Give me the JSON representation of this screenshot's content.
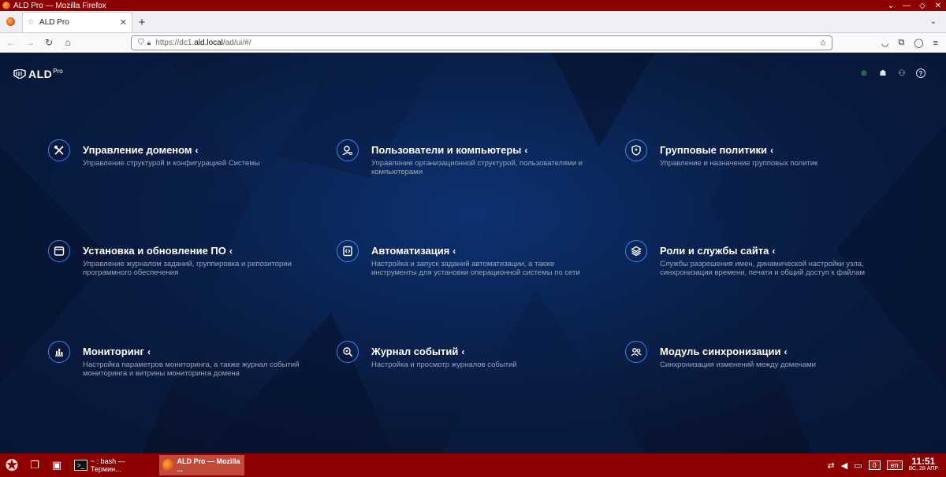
{
  "window": {
    "title": "ALD Pro — Mozilla Firefox"
  },
  "browser": {
    "tab": {
      "label": "ALD Pro",
      "icon": "star-outline-icon"
    },
    "url": {
      "prefix": "https://dc1.",
      "host": "ald.local",
      "path": "/ad/ui/#/"
    }
  },
  "app": {
    "logo": {
      "name": "ALD",
      "sup": "Pro"
    },
    "cards": [
      {
        "title": "Управление доменом",
        "desc": "Управление структурой и конфигурацией Системы",
        "icon": "tools-icon"
      },
      {
        "title": "Пользователи и компьютеры",
        "desc": "Управление организационной структурой, пользователями и компьютерами",
        "icon": "user-search-icon"
      },
      {
        "title": "Групповые политики",
        "desc": "Управление и назначение групповых политик",
        "icon": "shield-user-icon"
      },
      {
        "title": "Установка и обновление ПО",
        "desc": "Управление журналом заданий, группировка и репозитории программного обеспечения",
        "icon": "window-icon"
      },
      {
        "title": "Автоматизация",
        "desc": "Настройка и запуск заданий автоматизации, а также инструменты для установки операционной системы по сети",
        "icon": "code-file-icon"
      },
      {
        "title": "Роли и службы сайта",
        "desc": "Службы разрешения имен, динамической настройки узла, синхронизации времени, печати и общий доступ к файлам",
        "icon": "layers-icon"
      },
      {
        "title": "Мониторинг",
        "desc": "Настройка параметров мониторинга, а также журнал событий мониторинга и витрины мониторинга домена",
        "icon": "bar-chart-icon"
      },
      {
        "title": "Журнал событий",
        "desc": "Настройка и просмотр журналов событий",
        "icon": "magnifier-icon"
      },
      {
        "title": "Модуль синхронизации",
        "desc": "Синхронизация изменений между доменами",
        "icon": "users-icon"
      }
    ]
  },
  "taskbar": {
    "tasks": [
      {
        "label": "~ : bash — Термин..."
      },
      {
        "label": "ALD Pro — Mozilla ..."
      }
    ],
    "notif_count": "0",
    "lang": "en",
    "time": "11:51",
    "date": "ВС, 28 АПР"
  }
}
